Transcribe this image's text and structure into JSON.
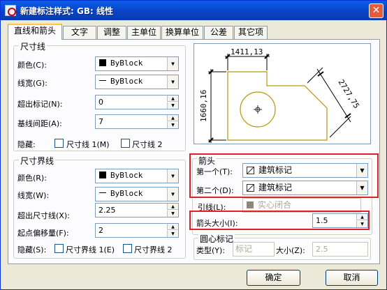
{
  "window": {
    "title": "新建标注样式: GB: 线性",
    "close": "✕"
  },
  "tabs": [
    "直线和箭头",
    "文字",
    "调整",
    "主单位",
    "换算单位",
    "公差",
    "其它项"
  ],
  "dim_line": {
    "title": "尺寸线",
    "color_label": "颜色(C):",
    "color_value": "ByBlock",
    "linewidth_label": "线宽(G):",
    "linewidth_value": "ByBlock",
    "extend_label": "超出标记(N):",
    "extend_value": "0",
    "spacing_label": "基线间距(A):",
    "spacing_value": "7",
    "hide_label": "隐藏:",
    "hide_line1": "尺寸线 1(M)",
    "hide_line2": "尺寸线 2"
  },
  "ext_line": {
    "title": "尺寸界线",
    "color_label": "颜色(R):",
    "color_value": "ByBlock",
    "linewidth_label": "线宽(W):",
    "linewidth_value": "ByBlock",
    "extend_label": "超出尺寸线(X):",
    "extend_value": "2.25",
    "offset_label": "起点偏移量(F):",
    "offset_value": "2",
    "hide_label": "隐藏(S):",
    "hide_line1": "尺寸界线 1(E)",
    "hide_line2": "尺寸界线 2"
  },
  "preview": {
    "dim_top": "1411,13",
    "dim_left": "1660,16",
    "dim_diag": "2727,75"
  },
  "arrows": {
    "title": "箭头",
    "first_label": "第一个(T):",
    "first_value": "建筑标记",
    "second_label": "第二个(D):",
    "second_value": "建筑标记",
    "leader_label": "引线(L):",
    "leader_value": "实心闭合",
    "size_label": "箭头大小(I):",
    "size_value": "1.5"
  },
  "center_mark": {
    "title": "圆心标记",
    "type_label": "类型(Y):",
    "type_value": "标记",
    "size_label": "大小(Z):",
    "size_value": "2.5"
  },
  "buttons": {
    "ok": "确定",
    "cancel": "取消"
  },
  "colors": {
    "title_bar": "#0842c4",
    "highlight": "#e21f26",
    "preview_geometry": "#b8960a"
  }
}
